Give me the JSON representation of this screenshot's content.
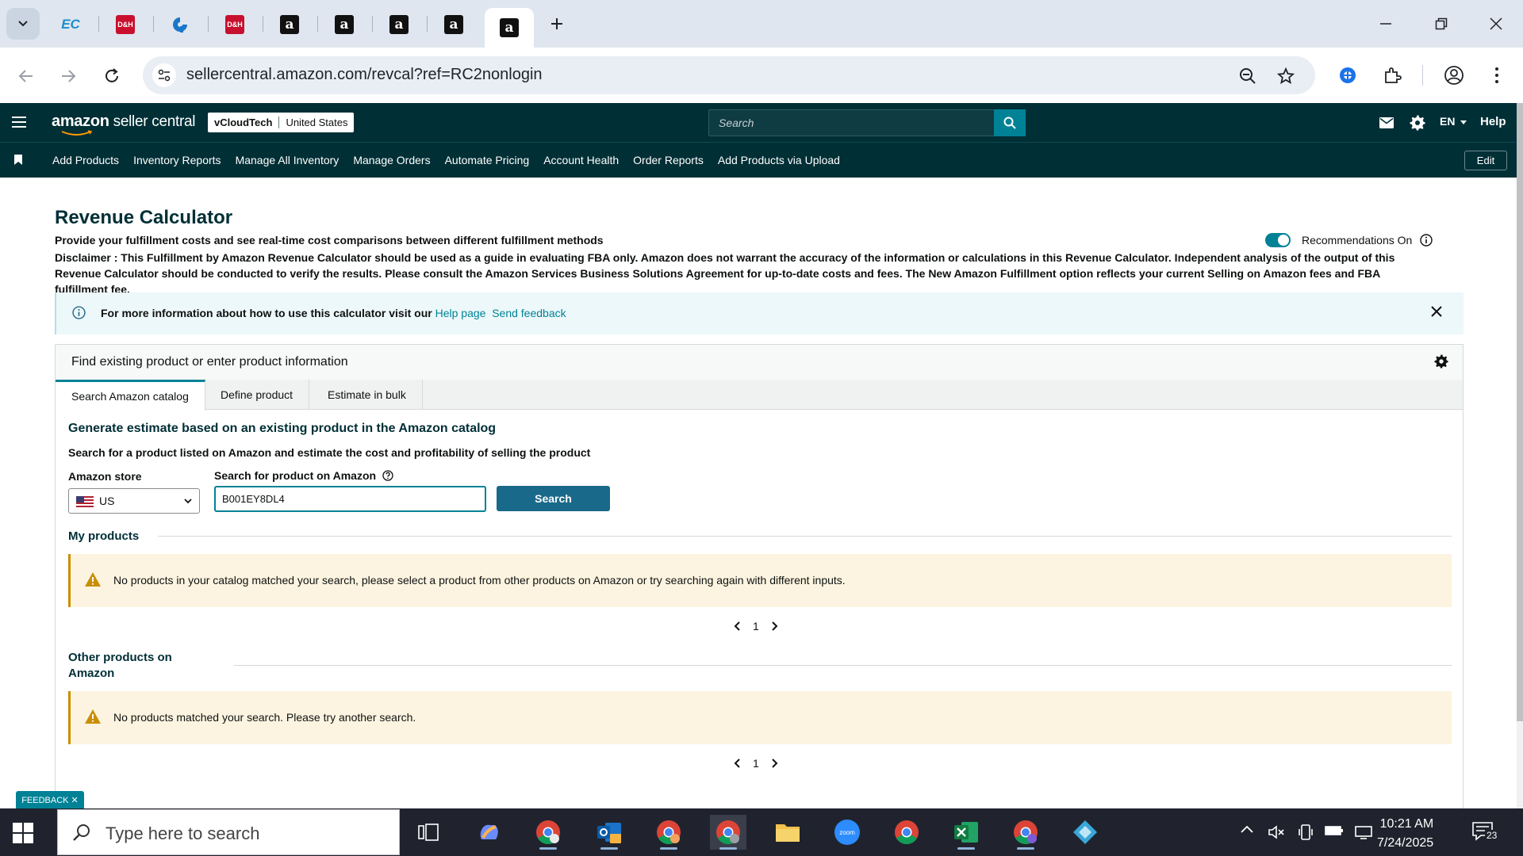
{
  "browser": {
    "tabs": [
      {
        "icon": "ec-icon",
        "label": "EC"
      },
      {
        "icon": "dh-icon",
        "label": "D&H"
      },
      {
        "icon": "q-icon",
        "label": ""
      },
      {
        "icon": "dh-icon",
        "label": "D&H"
      },
      {
        "icon": "amazon-icon",
        "label": "a"
      },
      {
        "icon": "amazon-icon",
        "label": "a"
      },
      {
        "icon": "amazon-icon",
        "label": "a"
      },
      {
        "icon": "amazon-icon",
        "label": "a"
      },
      {
        "icon": "amazon-icon",
        "label": "a",
        "active": true
      }
    ],
    "url": "sellercentral.amazon.com/revcal?ref=RC2nonlogin"
  },
  "header": {
    "logo": "amazon",
    "logo_suffix": "seller central",
    "account_name": "vCloudTech",
    "account_region": "United States",
    "search_placeholder": "Search",
    "language": "EN",
    "help": "Help"
  },
  "nav": {
    "links": [
      "Add Products",
      "Inventory Reports",
      "Manage All Inventory",
      "Manage Orders",
      "Automate Pricing",
      "Account Health",
      "Order Reports",
      "Add Products via Upload"
    ],
    "edit": "Edit"
  },
  "page": {
    "title": "Revenue Calculator",
    "subtitle": "Provide your fulfillment costs and see real-time cost comparisons between different fulfillment methods",
    "disclaimer": "Disclaimer : This Fulfillment by Amazon Revenue Calculator should be used as a guide in evaluating FBA only. Amazon does not warrant the accuracy of the information or calculations in this Revenue Calculator. Independent analysis of the output of this Revenue Calculator should be conducted to verify the results. Please consult the Amazon Services Business Solutions Agreement for up-to-date costs and fees. The New Amazon Fulfillment option reflects your current Selling on Amazon fees and FBA fulfillment fee.",
    "recommendations_label": "Recommendations On",
    "recommendations_on": true
  },
  "info_banner": {
    "text": "For more information about how to use this calculator visit our",
    "help_link": "Help page",
    "feedback_link": "Send feedback"
  },
  "panel": {
    "title": "Find existing product or enter product information",
    "tabs": [
      "Search Amazon catalog",
      "Define product",
      "Estimate in bulk"
    ],
    "active_tab": "Search Amazon catalog",
    "heading": "Generate estimate based on an existing product in the Amazon catalog",
    "subheading": "Search for a product listed on Amazon and estimate the cost and profitability of selling the product",
    "store_label": "Amazon store",
    "store_value": "US",
    "search_label": "Search for product on Amazon",
    "search_value": "B001EY8DL4",
    "search_button": "Search",
    "my_products_title": "My products",
    "my_products_warning": "No products in your catalog matched your search, please select a product from other products on Amazon or try searching again with different inputs.",
    "my_products_page": "1",
    "other_products_title": "Other products on Amazon",
    "other_products_warning": "No products matched your search. Please try another search.",
    "other_products_page": "1"
  },
  "feedback_tab": "FEEDBACK ✕",
  "taskbar": {
    "search_placeholder": "Type here to search",
    "time": "10:21 AM",
    "date": "7/24/2025",
    "notifications": "23"
  }
}
